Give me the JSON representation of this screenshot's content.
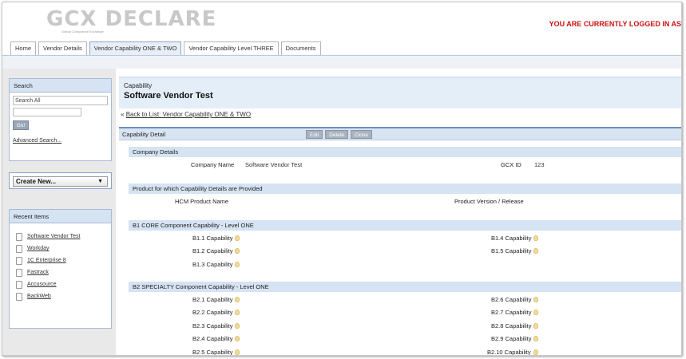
{
  "header": {
    "logo_text": "GCX DECLARE",
    "logo_subtext": "Global Compliance Exchange",
    "login_text": "YOU ARE CURRENTLY LOGGED IN AS"
  },
  "tabs": [
    {
      "label": "Home"
    },
    {
      "label": "Vendor Details"
    },
    {
      "label": "Vendor Capability ONE & TWO"
    },
    {
      "label": "Vendor Capability Level THREE"
    },
    {
      "label": "Documents"
    }
  ],
  "sidebar": {
    "search": {
      "title": "Search",
      "scope": "Search All",
      "placeholder": "",
      "go_label": "Go!",
      "advanced_label": "Advanced Search..."
    },
    "create_new_label": "Create New...",
    "recent": {
      "title": "Recent Items",
      "items": [
        {
          "label": "Software Vendor Test"
        },
        {
          "label": "Workday"
        },
        {
          "label": "1C Enterprise 8"
        },
        {
          "label": "Fastrack"
        },
        {
          "label": "Accusource"
        },
        {
          "label": "BackWeb"
        }
      ]
    }
  },
  "main": {
    "object_type": "Capability",
    "title": "Software Vendor Test",
    "back_prefix": "«",
    "back_link": "Back to List: Vendor Capability ONE & TWO",
    "detail_title": "Capability Detail",
    "buttons": {
      "edit": "Edit",
      "delete": "Delete",
      "clone": "Clone"
    },
    "company": {
      "section": "Company Details",
      "name_label": "Company Name",
      "name_value": "Software Vendor Test",
      "id_label": "GCX ID",
      "id_value": "123"
    },
    "product": {
      "section": "Product for which Capability Details are Provided",
      "name_label": "HCM Product Name",
      "version_label": "Product Version / Release"
    },
    "b1": {
      "section": "B1 CORE Component Capability - Level ONE",
      "left": [
        "B1.1 Capability",
        "B1.2 Capability",
        "B1.3 Capability"
      ],
      "right": [
        "B1.4 Capability",
        "B1.5 Capability"
      ]
    },
    "b2": {
      "section": "B2 SPECIALTY Component Capability - Level ONE",
      "left": [
        "B2.1 Capability",
        "B2.2 Capability",
        "B2.3 Capability",
        "B2.4 Capability",
        "B2.5 Capability"
      ],
      "right": [
        "B2.6 Capability",
        "B2.7 Capability",
        "B2.8 Capability",
        "B2.9 Capability",
        "B2.10 Capability"
      ]
    }
  }
}
